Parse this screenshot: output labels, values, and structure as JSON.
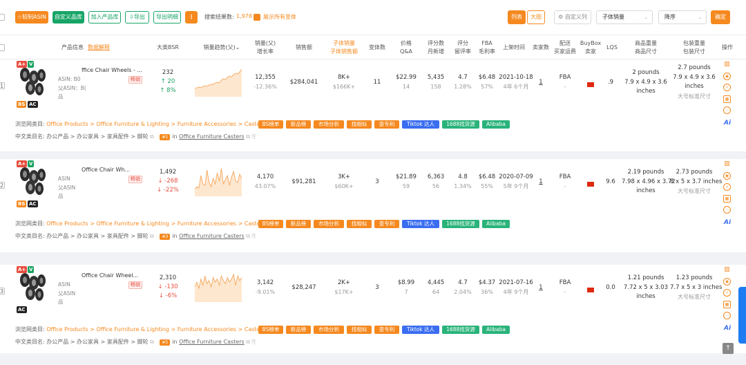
{
  "toolbar": {
    "favorite_asin": "较制ASIN",
    "custom_library": "自定义品库",
    "add_to_library": "加入产品库",
    "export": "导出",
    "export_detail": "导出明细",
    "more": "⋮",
    "result_label": "搜索结果数:",
    "result_count": "1,978",
    "show_all_variants": "展示所有变体",
    "view_list": "列表",
    "view_grid": "大图",
    "custom_columns": "自定义列",
    "sort_field": "子体销量",
    "sort_order": "降序",
    "confirm": "确定"
  },
  "columns": {
    "product_info": "产品信息",
    "data_explain": "数据解释",
    "bsr": "大类BSR",
    "sales_trend": "销量趋势(父)",
    "sales_line1": "销量(父)",
    "sales_line2": "增长率",
    "revenue": "销售额",
    "child_sales_line1": "子体销量",
    "child_sales_line2": "子体销售额",
    "variants": "变体数",
    "price_line1": "价格",
    "price_line2": "Q&A",
    "reviews_line1": "评分数",
    "reviews_line2": "月新增",
    "rating_line1": "评分",
    "rating_line2": "留评率",
    "fba_line1": "FBA",
    "fba_line2": "毛利率",
    "launch": "上架时间",
    "sellers": "卖家数",
    "fulfill_line1": "配送",
    "fulfill_line2": "买家运费",
    "buybox_line1": "BuyBox",
    "buybox_line2": "卖家",
    "lqs": "LQS",
    "item_line1": "商品重量",
    "item_line2": "商品尺寸",
    "pkg_line1": "包装重量",
    "pkg_line2": "包装尺寸",
    "actions": "操作"
  },
  "rows": [
    {
      "num": "1",
      "title": "ffice Chair Wheels - ...",
      "asin_label": "ASIN: B0",
      "parent_label": "父ASIN：B(",
      "brand_label": "品",
      "tag": "畅销",
      "badges_top": [
        "A+",
        "V"
      ],
      "badges_bottom": [
        "BS",
        "AC"
      ],
      "bsr": "232",
      "bsr_change": "↑ 20",
      "bsr_pct": "↑ 8%",
      "sales": "12,355",
      "sales_growth": "-12.36%",
      "revenue": "$284,041",
      "child_sales": "8K+",
      "child_revenue": "$166K+",
      "variants": "11",
      "price": "$22.99",
      "qa": "14",
      "reviews": "5,435",
      "reviews_new": "158",
      "rating": "4.7",
      "review_rate": "1.28%",
      "fba": "$6.48",
      "margin": "57%",
      "launch_date": "2021-10-18",
      "launch_age": "4年 6个月",
      "sellers": "1",
      "fulfillment": "FBA",
      "shipping": "-",
      "lqs": ".9",
      "item_weight": "2 pounds",
      "item_dim": "7.9 x 4.9 x 3.6",
      "item_unit": "inches",
      "pkg_weight": "2.7 pounds",
      "pkg_dim": "7.9 x 4.9 x 3.6",
      "pkg_unit": "inches",
      "pkg_std": "大号标准尺寸",
      "category_label": "浏览网类目:",
      "category_path": "Office Products > Office Furniture & Lighting > Furniture Accessories > Casters",
      "cn_label": "中文类目名:",
      "cn_path": "办公产品 > 办公家具 > 家具配件 > 脚轮",
      "rank": "#1",
      "in_text": "in",
      "subcategory": "Office Furniture Casters",
      "trend": [
        12,
        13,
        14,
        13,
        15,
        16,
        15,
        17,
        18,
        18,
        20,
        21,
        20,
        24,
        26,
        25,
        28,
        30,
        29,
        32,
        34,
        33,
        36,
        40
      ]
    },
    {
      "num": "2",
      "title": "Office Chair Wh...",
      "asin_label": "ASIN",
      "parent_label": "父ASIN",
      "brand_label": "品",
      "tag": "畅销",
      "badges_top": [
        "A+",
        "V"
      ],
      "badges_bottom": [
        "BS",
        "AC"
      ],
      "bsr": "1,492",
      "bsr_change": "↓ -268",
      "bsr_pct": "↓ -22%",
      "sales": "4,170",
      "sales_growth": "43.07%",
      "revenue": "$91,281",
      "child_sales": "3K+",
      "child_revenue": "$60K+",
      "variants": "3",
      "price": "$21.89",
      "qa": "59",
      "reviews": "6,363",
      "reviews_new": "56",
      "rating": "4.8",
      "review_rate": "1.34%",
      "fba": "$6.48",
      "margin": "55%",
      "launch_date": "2020-07-09",
      "launch_age": "5年 9个月",
      "sellers": "1",
      "fulfillment": "FBA",
      "shipping": "-",
      "lqs": "9.6",
      "item_weight": "2.19 pounds",
      "item_dim": "7.98 x 4.96 x 3.72",
      "item_unit": "inches",
      "pkg_weight": "2.73 pounds",
      "pkg_dim": "8 x 5 x 3.7 inches",
      "pkg_std": "大号标准尺寸",
      "category_label": "浏览网类目:",
      "category_path": "Office Products > Office Furniture & Lighting > Furniture Accessories > Casters",
      "cn_label": "中文类目名:",
      "cn_path": "办公产品 > 办公家具 > 家具配件 > 脚轮",
      "rank": "#3",
      "in_text": "in",
      "subcategory": "Office Furniture Casters",
      "trend": [
        10,
        14,
        12,
        30,
        18,
        16,
        38,
        20,
        14,
        26,
        18,
        34,
        22,
        40,
        18,
        24,
        30,
        16,
        28,
        36,
        22,
        20,
        32,
        26
      ]
    },
    {
      "num": "3",
      "title": "Office Chair Wheel...",
      "asin_label": "ASIN",
      "parent_label": "父ASIN",
      "brand_label": "品",
      "tag": "畅销",
      "badges_top": [
        "A+",
        "V"
      ],
      "badges_bottom": [
        "AC"
      ],
      "bsr": "2,310",
      "bsr_change": "↓ -130",
      "bsr_pct": "↓ -6%",
      "sales": "3,142",
      "sales_growth": "-9.01%",
      "revenue": "$28,247",
      "child_sales": "2K+",
      "child_revenue": "$17K+",
      "variants": "3",
      "price": "$8.99",
      "qa": "7",
      "reviews": "4,445",
      "reviews_new": "64",
      "rating": "4.7",
      "review_rate": "2.04%",
      "fba": "$4.37",
      "margin": "36%",
      "launch_date": "2021-07-16",
      "launch_age": "4年 9个月",
      "sellers": "1",
      "fulfillment": "FBA",
      "shipping": "-",
      "lqs": "0.0",
      "item_weight": "1.21 pounds",
      "item_dim": "7.72 x 5 x 3.03",
      "item_unit": "inches",
      "pkg_weight": "1.23 pounds",
      "pkg_dim": "7.7 x 5 x 3 inches",
      "pkg_std": "大号标准尺寸",
      "category_label": "浏览网类目:",
      "category_path": "Office Products > Office Furniture & Lighting > Furniture Accessories > Casters",
      "cn_label": "中文类目名:",
      "cn_path": "办公产品 > 办公家具 > 家具配件 > 脚轮",
      "rank": "#5",
      "in_text": "in",
      "subcategory": "Office Furniture Casters",
      "trend": [
        20,
        26,
        18,
        30,
        22,
        34,
        24,
        28,
        20,
        32,
        26,
        30,
        22,
        34,
        28,
        24,
        32,
        26,
        30,
        36,
        22,
        34,
        28,
        32
      ]
    }
  ],
  "chips": [
    "BS榜单",
    "新品榜",
    "市场分析",
    "找相似",
    "查专利",
    "Tiktok 达人",
    "1688找货源",
    "Alibaba"
  ],
  "icons": {
    "ai": "Ai",
    "back_to_top": "↑"
  },
  "colors": {
    "accent": "#f5891f",
    "primary_green": "#17a567",
    "tiktok_blue": "#3a6df0",
    "source_green": "#29b37a",
    "down_red": "#e74c3c",
    "up_green": "#1aa260"
  }
}
